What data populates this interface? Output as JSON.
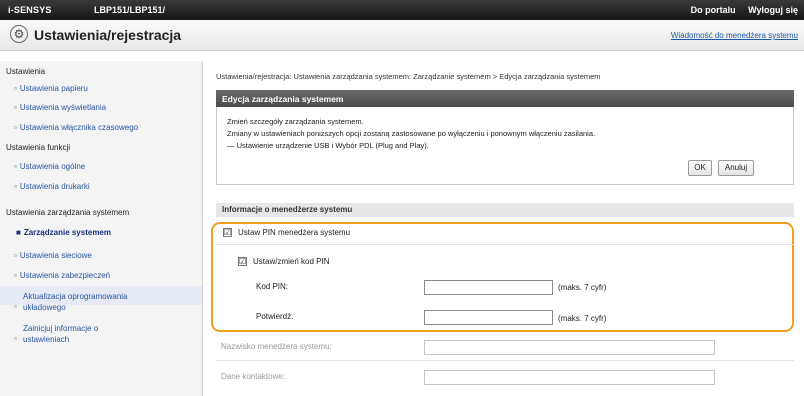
{
  "topbar": {
    "brand": "i-SENSYS",
    "model": "LBP151/LBP151/",
    "portal_link": "Do portalu",
    "logout_link": "Wyloguj się"
  },
  "titlebar": {
    "icon": "gear-icon",
    "title": "Ustawienia/rejestracja",
    "message_link": "Wiadomość do menedżera systemu"
  },
  "sidebar": {
    "groups": [
      {
        "heading": "Ustawienia",
        "items": [
          {
            "label": "Ustawienia papieru"
          },
          {
            "label": "Ustawienia wyświetlania"
          },
          {
            "label": "Ustawienia włącznika czasowego"
          }
        ]
      },
      {
        "heading": "Ustawienia funkcji",
        "items": [
          {
            "label": "Ustawienia ogólne"
          },
          {
            "label": "Ustawienia drukarki"
          }
        ]
      },
      {
        "heading": "Ustawienia zarządzania systemem",
        "items": [
          {
            "label": "Zarządzanie systemem"
          },
          {
            "label": "Ustawienia sieciowe"
          },
          {
            "label": "Ustawienia zabezpieczeń"
          },
          {
            "label_line1": "Aktualizacja oprogramowania",
            "label_line2": "układowego"
          },
          {
            "label_line1": "Zainicjuj informacje o",
            "label_line2": "ustawieniach"
          }
        ]
      }
    ]
  },
  "main": {
    "breadcrumb": "Ustawienia/rejestracja: Ustawienia zarządzania systemem: Zarządzanie systemem > Edycja zarządzania systemem",
    "panel_title": "Edycja zarządzania systemem",
    "desc_line1": "Zmień szczegóły zarządzania systemem.",
    "desc_line2": "Zmiany w ustawieniach poniższych opcji zostaną zastosowane po wyłączeniu i ponownym włączeniu zasilania.",
    "desc_line3": "— Ustawienie urządzenie USB i Wybór PDL (Plug and Play).",
    "ok_label": "OK",
    "cancel_label": "Anuluj",
    "section_title": "Informacje o menedżerze systemu",
    "set_pin_label": "Ustaw PIN menedżera systemu",
    "set_pin_checked": "☑",
    "change_pin_label": "Ustaw/zmień kod PIN",
    "change_pin_checked": "☑",
    "pin_label": "Kod PIN:",
    "pin_hint": "(maks. 7 cyfr)",
    "confirm_label": "Potwierdź:",
    "confirm_hint": "(maks. 7 cyfr)",
    "manager_name_label": "Nazwisko menedżera systemu:",
    "contact_label": "Dane kontaktowe:"
  },
  "colors": {
    "highlight": "#f0a020",
    "panel_header": "#555555",
    "link": "#2b55a0"
  }
}
